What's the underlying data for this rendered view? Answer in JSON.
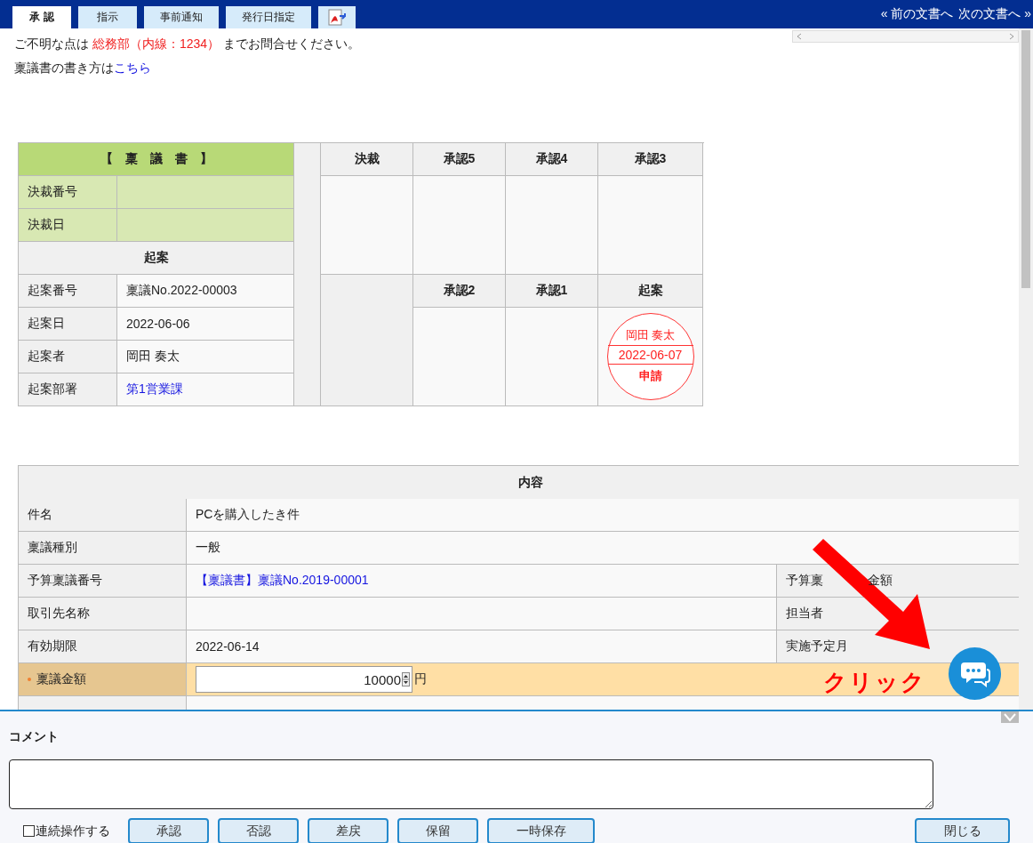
{
  "tabs": [
    {
      "label": "承 認",
      "selected": true
    },
    {
      "label": "指示",
      "selected": false
    },
    {
      "label": "事前通知",
      "selected": false
    },
    {
      "label": "発行日指定",
      "selected": false
    }
  ],
  "nav": {
    "prev": "« 前の文書へ",
    "next": "次の文書へ »"
  },
  "notice": {
    "before": "ご不明な点は",
    "contact": "総務部（内線：1234）",
    "after": "までお問合せください。"
  },
  "howto": {
    "text": "稟議書の書き方は",
    "link": "こちら"
  },
  "form": {
    "title": "【　稟　議　書　】",
    "rows": [
      {
        "label": "決裁番号",
        "value": "",
        "kind": "green"
      },
      {
        "label": "決裁日",
        "value": "",
        "kind": "green"
      }
    ],
    "section": "起案",
    "draft_rows": [
      {
        "label": "起案番号",
        "value": "稟議No.2022-00003",
        "link": false
      },
      {
        "label": "起案日",
        "value": "2022-06-06",
        "link": false
      },
      {
        "label": "起案者",
        "value": "岡田 奏太",
        "link": false
      },
      {
        "label": "起案部署",
        "value": "第1営業課",
        "link": true
      }
    ]
  },
  "approvals_top": [
    "決裁",
    "承認5",
    "承認4",
    "承認3"
  ],
  "approvals_bottom": [
    "承認2",
    "承認1",
    "起案"
  ],
  "stamp": {
    "name": "岡田 奏太",
    "date": "2022-06-07",
    "label": "申請"
  },
  "content": {
    "title": "内容",
    "rows": [
      {
        "label": "件名",
        "value": "PCを購入したき件",
        "link": false
      },
      {
        "label": "稟議種別",
        "value": "一般",
        "link": false
      },
      {
        "label": "予算稟議番号",
        "value": "【稟議書】稟議No.2019-00001",
        "link": true,
        "side": "予算稟",
        "side_end": "金額"
      },
      {
        "label": "取引先名称",
        "value": "",
        "side": "担当者"
      },
      {
        "label": "有効期限",
        "value": "2022-06-14",
        "link": false,
        "side": "実施予定月"
      }
    ],
    "amount": {
      "label": "稟議金額",
      "value": "10000",
      "unit": "円",
      "required": true
    }
  },
  "callout": "クリック",
  "comment": {
    "label": "コメント"
  },
  "continuous": {
    "label": "連続操作する",
    "checked": false
  },
  "buttons": [
    "承認",
    "否認",
    "差戻",
    "保留",
    "一時保存"
  ],
  "close": "閉じる"
}
